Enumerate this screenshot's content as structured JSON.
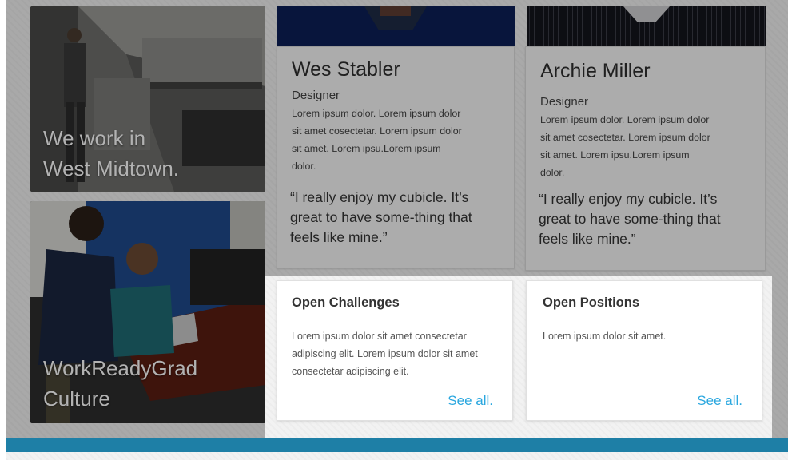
{
  "tiles": {
    "office": {
      "caption_line1": "We work in",
      "caption_line2": "West Midtown."
    },
    "culture": {
      "caption_line1": "WorkReadyGrad",
      "caption_line2": "Culture"
    }
  },
  "people": [
    {
      "name": "Wes Stabler",
      "role": "Designer",
      "bio": "Lorem ipsum dolor. Lorem ipsum dolor sit amet cosectetar. Lorem ipsum dolor sit amet. Lorem ipsu.Lorem ipsum dolor.",
      "quote": "“I really enjoy my cubicle. It’s great to have some-thing that feels like mine.”"
    },
    {
      "name": "Archie Miller",
      "role": "Designer",
      "bio": "Lorem ipsum dolor. Lorem ipsum dolor sit amet cosectetar. Lorem ipsum dolor sit amet. Lorem ipsu.Lorem ipsum dolor.",
      "quote": "“I really enjoy my cubicle. It’s great to have some-thing that feels like mine.”"
    }
  ],
  "cards": {
    "challenges": {
      "title": "Open Challenges",
      "text": "Lorem ipsum dolor sit amet consectetar adipiscing elit. Lorem ipsum dolor sit amet consectetar adipiscing elit.",
      "link": "See all."
    },
    "positions": {
      "title": "Open Positions",
      "text": "Lorem ipsum dolor sit amet.",
      "link": "See all."
    }
  },
  "colors": {
    "accent": "#2aa7df",
    "footer_bar": "#1e7fa6"
  }
}
